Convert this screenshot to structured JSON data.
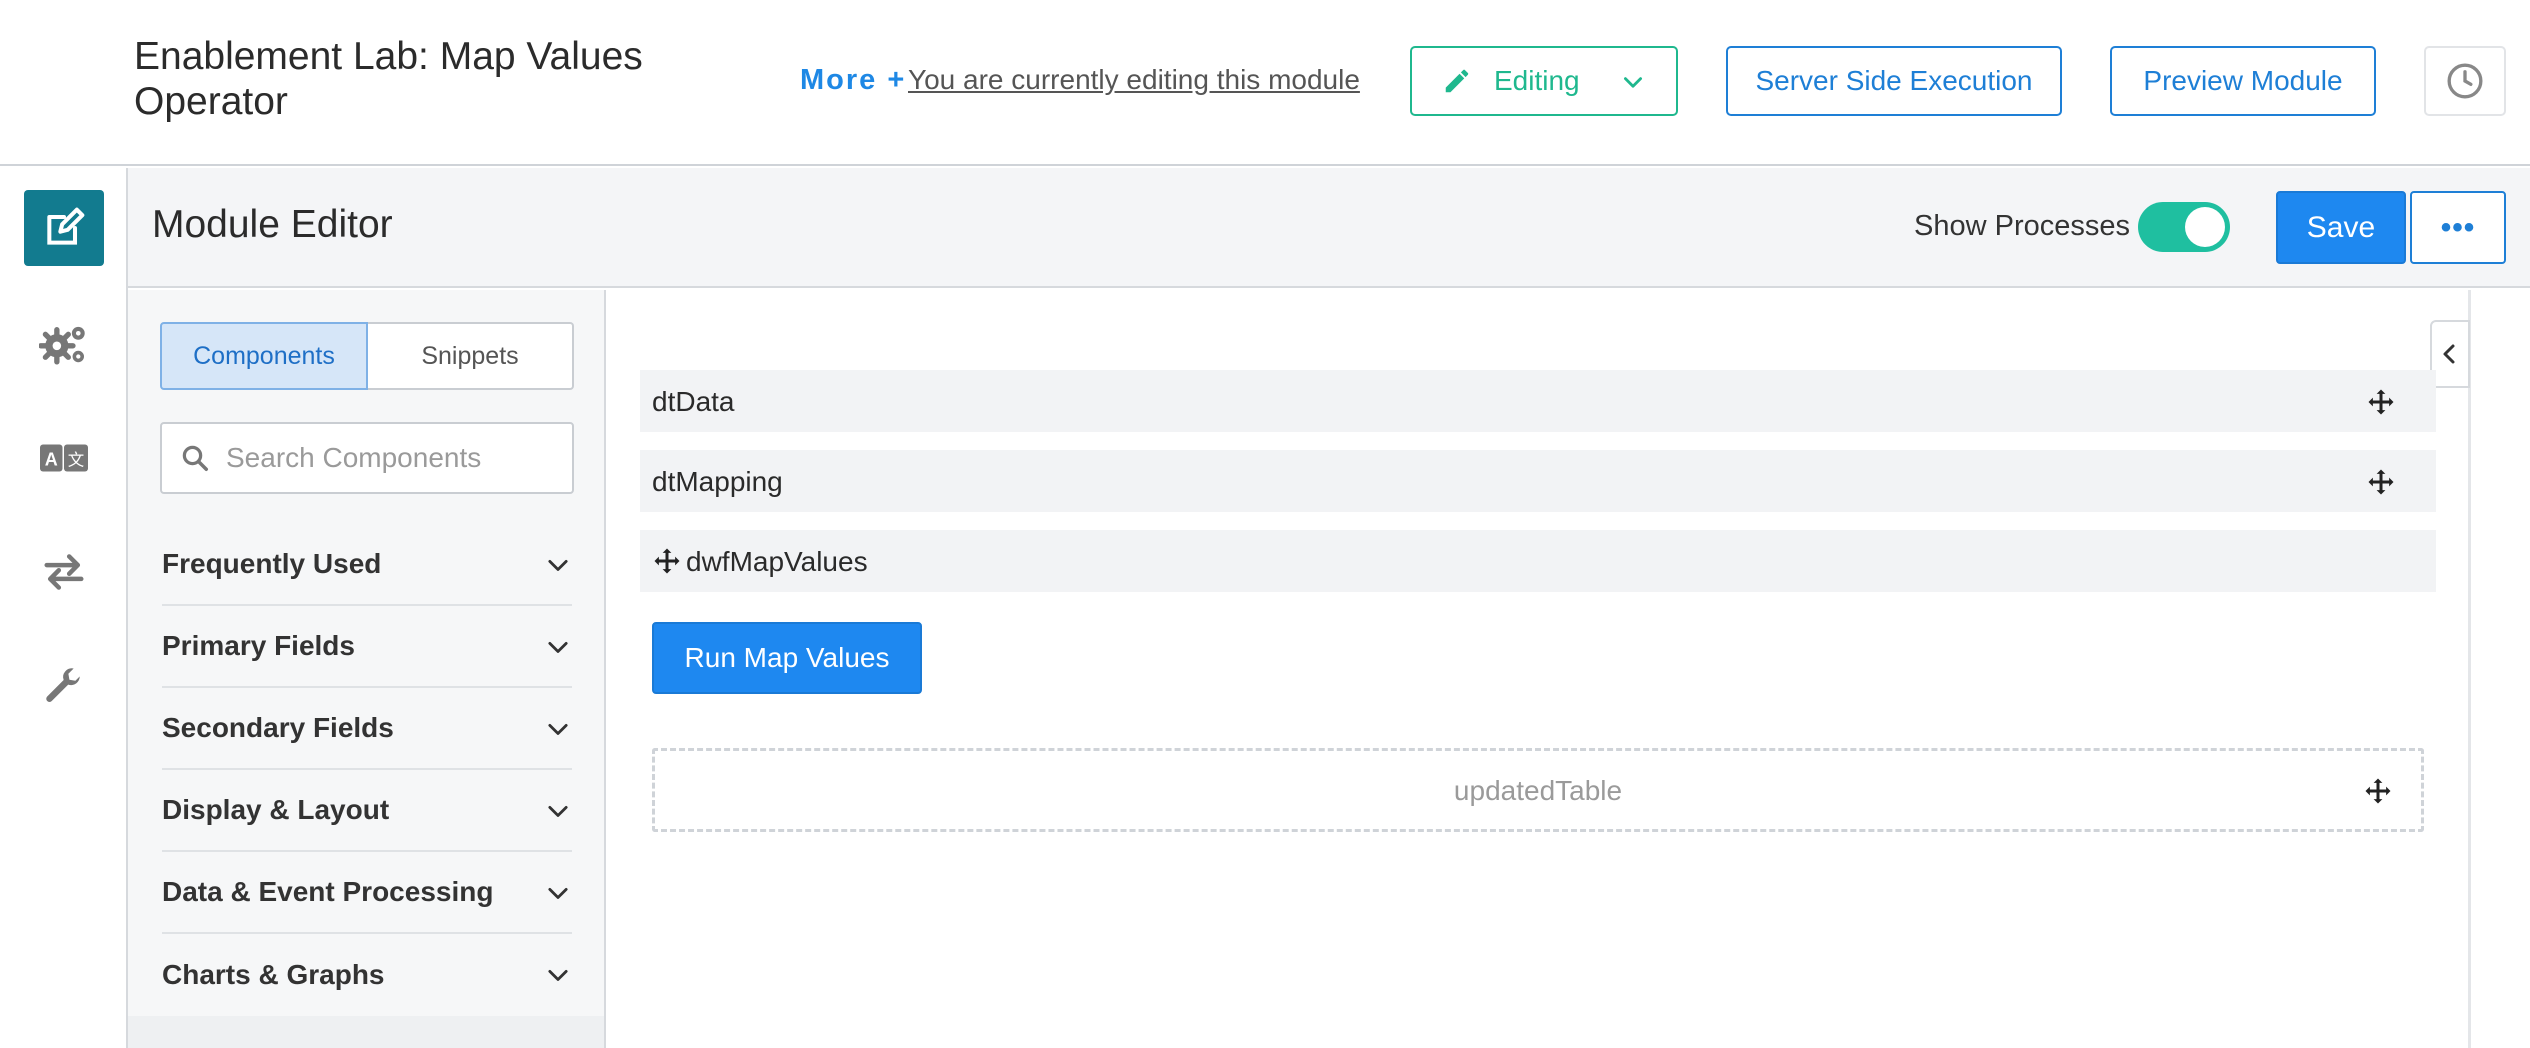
{
  "header": {
    "title": "Enablement Lab: Map Values Operator",
    "more_link": "More +",
    "editing_note": "You are currently editing this module",
    "editing_label": "Editing",
    "server_side_label": "Server Side Execution",
    "preview_label": "Preview Module"
  },
  "rail": {
    "items": [
      "edit-icon",
      "gears-icon",
      "translate-icon",
      "exchange-icon",
      "wrench-icon"
    ],
    "active": "edit-icon"
  },
  "editor": {
    "title": "Module Editor",
    "show_processes_label": "Show Processes",
    "show_processes_on": true,
    "save_label": "Save",
    "more_label": "•••"
  },
  "panel": {
    "tabs": [
      {
        "label": "Components",
        "active": true
      },
      {
        "label": "Snippets",
        "active": false
      }
    ],
    "search_placeholder": "Search Components",
    "categories": [
      "Frequently Used",
      "Primary Fields",
      "Secondary Fields",
      "Display & Layout",
      "Data & Event Processing",
      "Charts & Graphs"
    ]
  },
  "canvas": {
    "rows": [
      "dtData",
      "dtMapping",
      "dwfMapValues"
    ],
    "run_button_label": "Run Map Values",
    "placeholder_label": "updatedTable"
  },
  "colors": {
    "accent_blue": "#1e88f0",
    "editing_green": "#1fb88e",
    "rail_active": "#127b8f",
    "toggle_on": "#1fbfa0"
  }
}
